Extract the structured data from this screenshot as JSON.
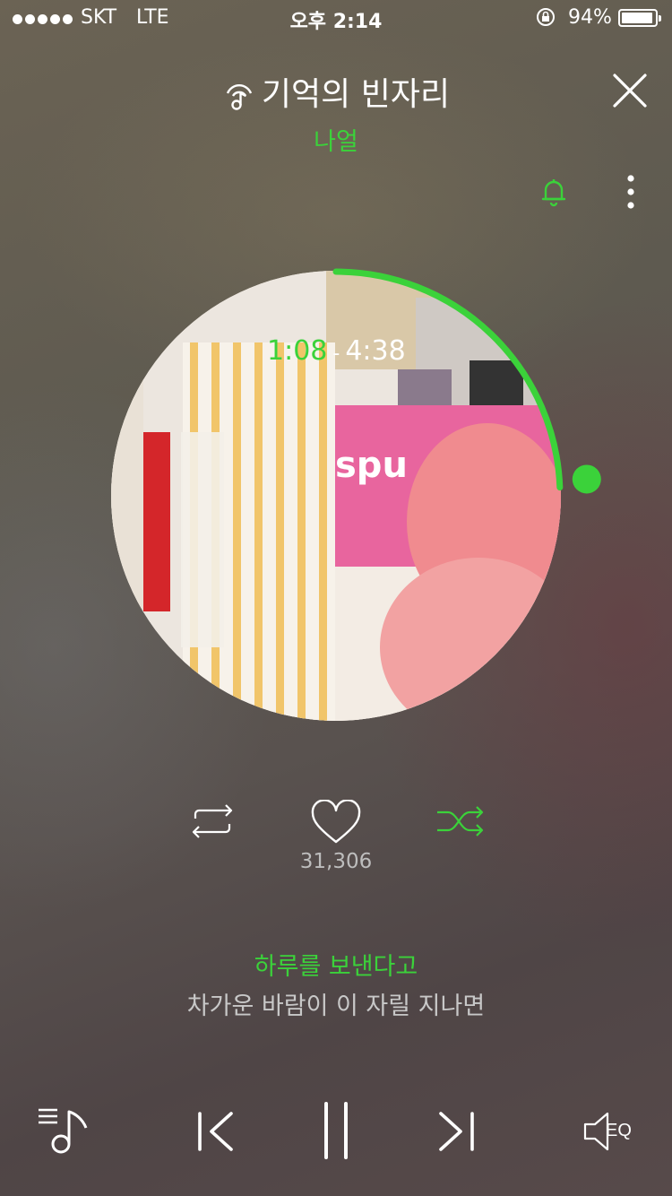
{
  "status_bar": {
    "carrier": "SKT",
    "network": "LTE",
    "time": "오후 2:14",
    "battery": "94%",
    "battery_level": 0.94
  },
  "player": {
    "title": "기억의 빈자리",
    "artist": "나얼",
    "elapsed": "1:08",
    "duration": "4:38",
    "progress": 0.244,
    "likes": "31,306",
    "lyric_current": "하루를 보낸다고",
    "lyric_next": "차가운 바람이 이 자릴 지나면",
    "eq_label": "EQ"
  },
  "colors": {
    "accent": "#3bd23a",
    "text": "#ffffff",
    "muted": "#bdbdbd"
  },
  "icons": {
    "title_icon": "streaming-music-icon",
    "close": "close-icon",
    "alarm": "bell-icon",
    "more": "more-vertical-icon",
    "repeat": "repeat-icon",
    "like": "heart-icon",
    "shuffle": "shuffle-icon",
    "playlist": "playlist-icon",
    "prev": "previous-icon",
    "pause": "pause-icon",
    "next": "next-icon",
    "eq": "speaker-eq-icon"
  }
}
